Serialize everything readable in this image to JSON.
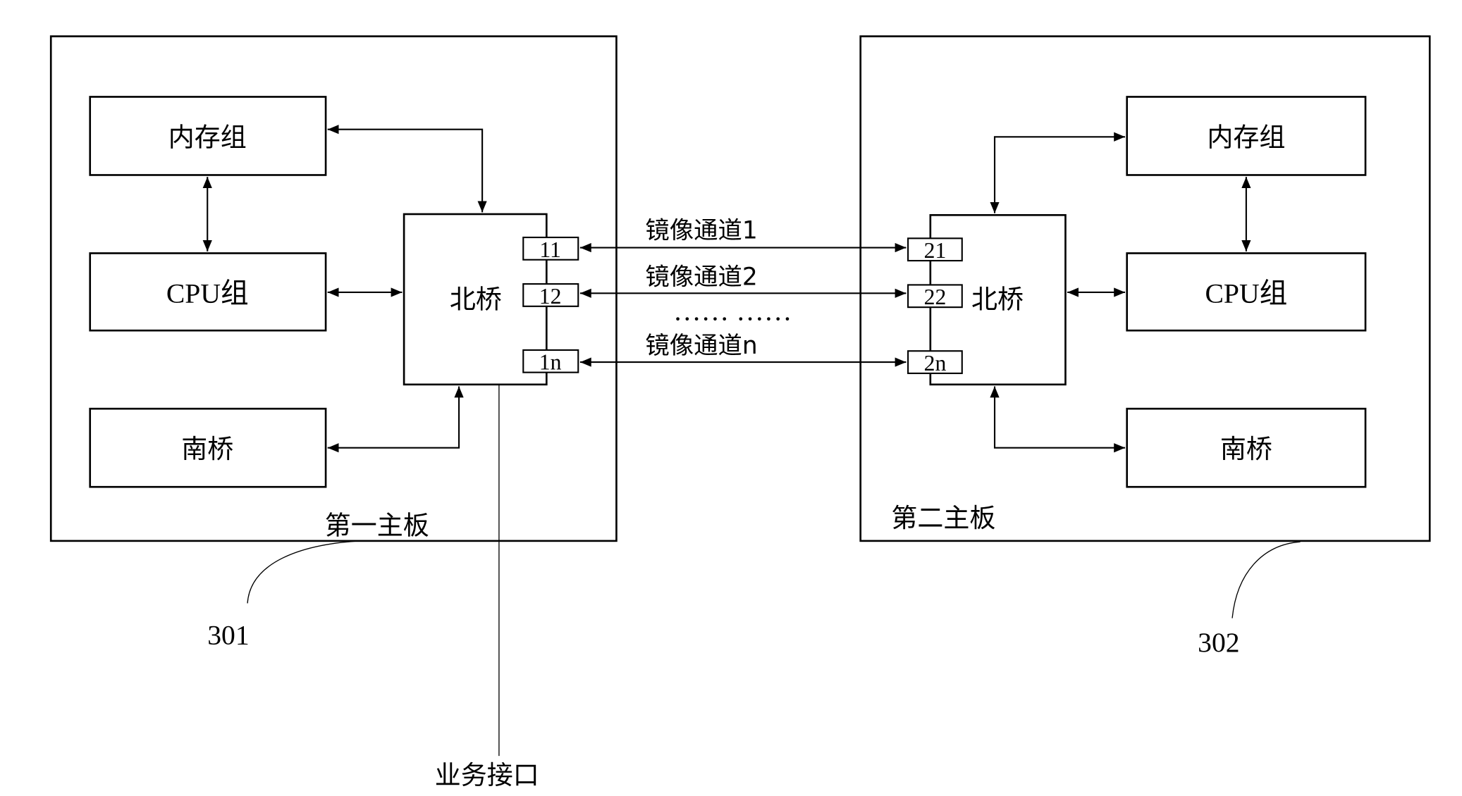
{
  "diagram": {
    "board1": {
      "label": "第一主板",
      "ref": "301",
      "memory": "内存组",
      "cpu": "CPU组",
      "southbridge": "南桥",
      "northbridge": "北桥",
      "ports": [
        "11",
        "12",
        "1n"
      ]
    },
    "board2": {
      "label": "第二主板",
      "ref": "302",
      "memory": "内存组",
      "cpu": "CPU组",
      "southbridge": "南桥",
      "northbridge": "北桥",
      "ports": [
        "21",
        "22",
        "2n"
      ]
    },
    "channels": [
      "镜像通道1",
      "镜像通道2",
      "镜像通道n"
    ],
    "ellipsis": "…… ……",
    "service_interface": "业务接口"
  }
}
